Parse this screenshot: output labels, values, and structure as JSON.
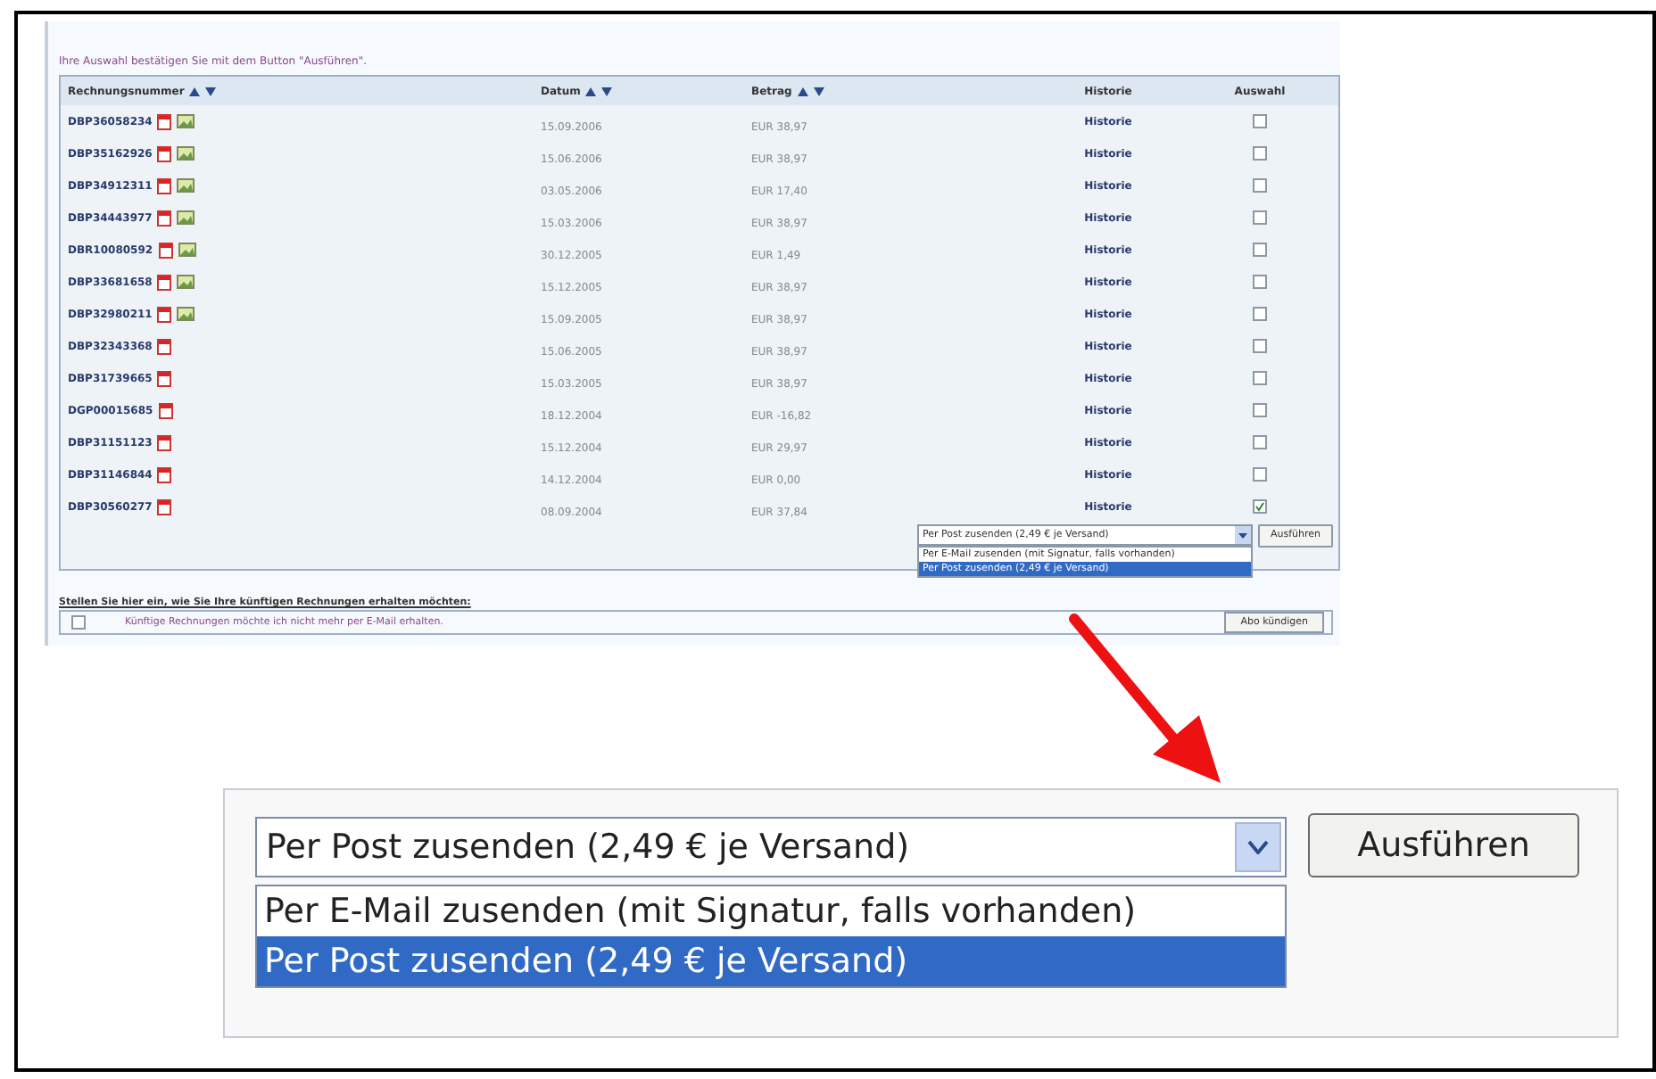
{
  "intro": "Ihre Auswahl bestätigen Sie mit dem Button \"Ausführen\".",
  "table": {
    "columns": [
      "Rechnungsnummer",
      "Datum",
      "Betrag",
      "Historie",
      "Auswahl"
    ],
    "rows": [
      {
        "number": "DBP36058234",
        "image_icon": true,
        "date": "15.09.2006",
        "amount": "EUR 38,97",
        "history": "Historie",
        "checked": false
      },
      {
        "number": "DBP35162926",
        "image_icon": true,
        "date": "15.06.2006",
        "amount": "EUR 38,97",
        "history": "Historie",
        "checked": false
      },
      {
        "number": "DBP34912311",
        "image_icon": true,
        "date": "03.05.2006",
        "amount": "EUR 17,40",
        "history": "Historie",
        "checked": false
      },
      {
        "number": "DBP34443977",
        "image_icon": true,
        "date": "15.03.2006",
        "amount": "EUR 38,97",
        "history": "Historie",
        "checked": false
      },
      {
        "number": "DBR10080592",
        "image_icon": true,
        "date": "30.12.2005",
        "amount": "EUR 1,49",
        "history": "Historie",
        "checked": false
      },
      {
        "number": "DBP33681658",
        "image_icon": true,
        "date": "15.12.2005",
        "amount": "EUR 38,97",
        "history": "Historie",
        "checked": false
      },
      {
        "number": "DBP32980211",
        "image_icon": true,
        "date": "15.09.2005",
        "amount": "EUR 38,97",
        "history": "Historie",
        "checked": false
      },
      {
        "number": "DBP32343368",
        "image_icon": false,
        "date": "15.06.2005",
        "amount": "EUR 38,97",
        "history": "Historie",
        "checked": false
      },
      {
        "number": "DBP31739665",
        "image_icon": false,
        "date": "15.03.2005",
        "amount": "EUR 38,97",
        "history": "Historie",
        "checked": false
      },
      {
        "number": "DGP00015685",
        "image_icon": false,
        "date": "18.12.2004",
        "amount": "EUR -16,82",
        "history": "Historie",
        "checked": false
      },
      {
        "number": "DBP31151123",
        "image_icon": false,
        "date": "15.12.2004",
        "amount": "EUR 29,97",
        "history": "Historie",
        "checked": false
      },
      {
        "number": "DBP31146844",
        "image_icon": false,
        "date": "14.12.2004",
        "amount": "EUR 0,00",
        "history": "Historie",
        "checked": false
      },
      {
        "number": "DBP30560277",
        "image_icon": false,
        "date": "08.09.2004",
        "amount": "EUR 37,84",
        "history": "Historie",
        "checked": true
      }
    ]
  },
  "small_select": {
    "value": "Per Post zusenden (2,49 € je Versand)",
    "options": [
      {
        "label": "Per E-Mail zusenden (mit Signatur, falls vorhanden)",
        "selected": false
      },
      {
        "label": "Per Post zusenden (2,49 € je Versand)",
        "selected": true
      }
    ],
    "button": "Ausführen"
  },
  "future": {
    "heading": "Stellen Sie hier ein, wie Sie Ihre künftigen Rechnungen erhalten möchten:",
    "checked": false,
    "label": "Künftige Rechnungen möchte ich nicht mehr per E-Mail erhalten.",
    "button": "Abo kündigen"
  },
  "zoomed_select": {
    "value": "Per Post zusenden (2,49 € je Versand)",
    "options": [
      {
        "label": "Per E-Mail zusenden (mit Signatur, falls vorhanden)",
        "selected": false
      },
      {
        "label": "Per Post zusenden (2,49 € je Versand)",
        "selected": true
      }
    ],
    "button": "Ausführen"
  }
}
